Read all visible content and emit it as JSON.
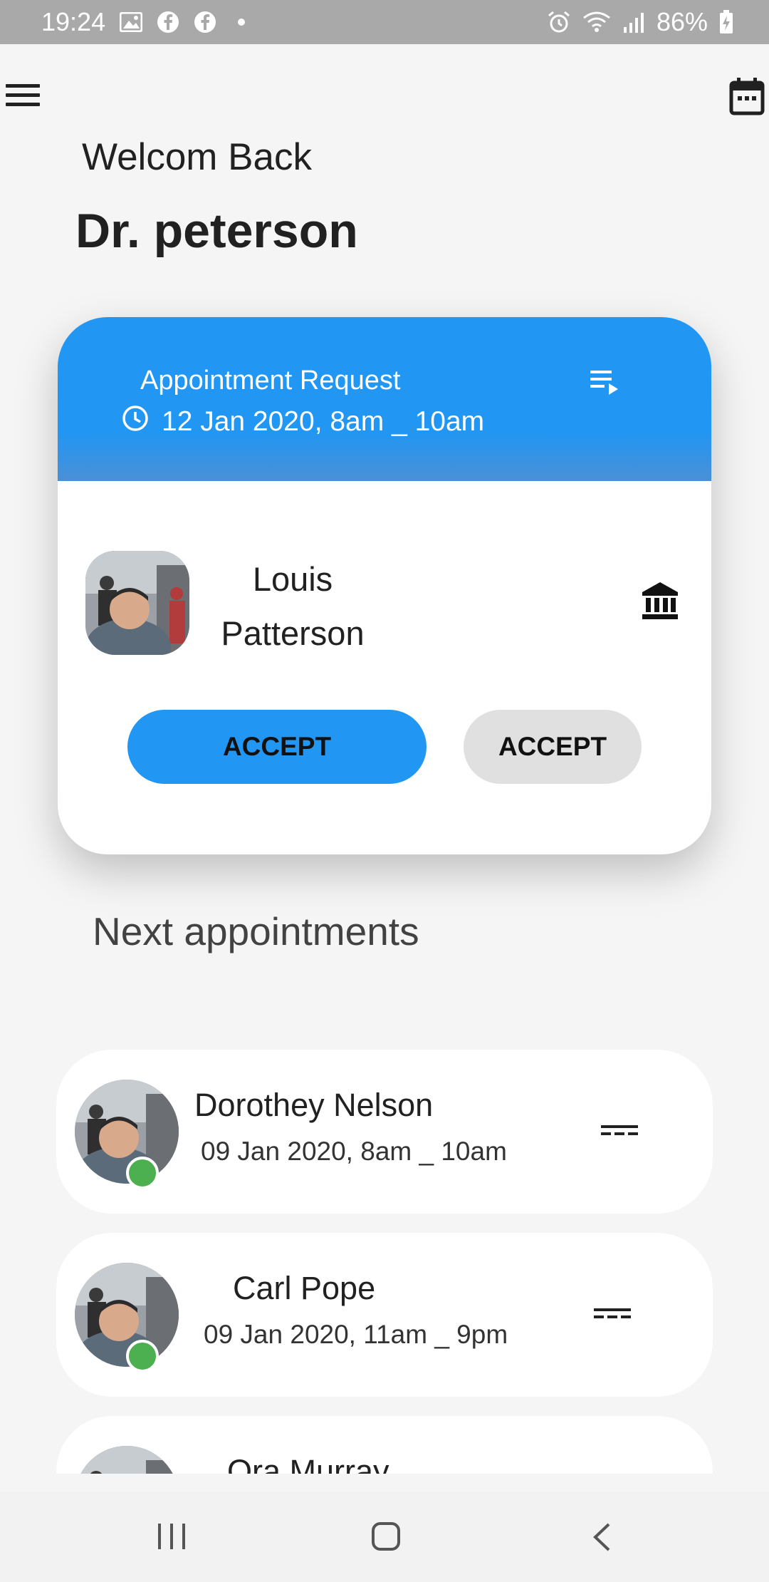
{
  "status_bar": {
    "time": "19:24",
    "battery": "86%"
  },
  "header": {
    "welcome": "Welcom Back",
    "doctor_name": "Dr. peterson"
  },
  "request_card": {
    "title": "Appointment Request",
    "datetime": "12 Jan 2020, 8am _ 10am",
    "patient_first": "Louis",
    "patient_last": "Patterson",
    "accept_label": "ACCEPT",
    "secondary_label": "ACCEPT"
  },
  "next_section": {
    "title": "Next appointments"
  },
  "appointments": [
    {
      "name": "Dorothey Nelson",
      "datetime": "09 Jan 2020, 8am _ 10am"
    },
    {
      "name": "Carl Pope",
      "datetime": "09 Jan 2020, 11am _ 9pm"
    },
    {
      "name": "Ora Murray",
      "datetime": ""
    }
  ],
  "colors": {
    "primary": "#2196f3",
    "online": "#4caf50",
    "background": "#f5f5f5",
    "status_bar": "#a9a9a9"
  },
  "icons": {
    "menu": "hamburger-menu-icon",
    "calendar": "calendar-icon",
    "clock": "clock-icon",
    "playlist": "playlist-play-icon",
    "bank": "bank-icon",
    "appointment_options": "dashes-menu-icon"
  }
}
